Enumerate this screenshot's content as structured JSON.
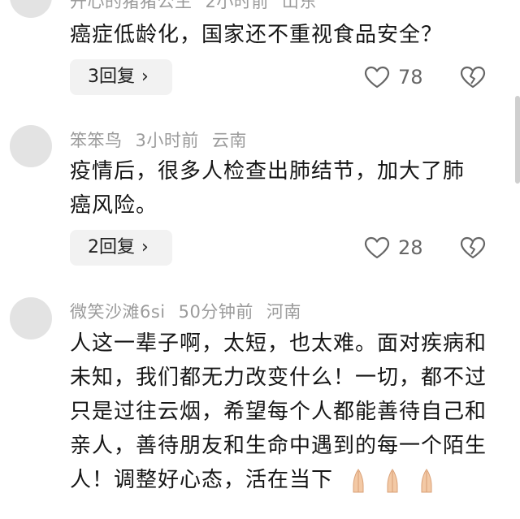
{
  "comments": [
    {
      "author": "开心的猪猪公主",
      "time": "2小时前",
      "location": "山东",
      "text": "癌症低龄化，国家还不重视食品安全？",
      "reply_label": "3回复",
      "likes": "78"
    },
    {
      "author": "笨笨鸟",
      "time": "3小时前",
      "location": "云南",
      "text": "疫情后，很多人检查出肺结节，加大了肺癌风险。",
      "reply_label": "2回复",
      "likes": "28"
    },
    {
      "author": "微笑沙滩6si",
      "time": "50分钟前",
      "location": "河南",
      "text": "人这一辈子啊，太短，也太难。面对疾病和未知，我们都无力改变什么！一切，都不过只是过往云烟，希望每个人都能善待自己和亲人，善待朋友和生命中遇到的每一个陌生人！调整好心态，活在当下",
      "emoji": [
        "pray-hands",
        "pray-hands",
        "pray-hands"
      ]
    }
  ],
  "icons": {
    "like": "heart-outline-icon",
    "dislike": "broken-heart-icon",
    "reply_arrow": "chevron-right-icon",
    "emoji": "pray-hands-icon"
  },
  "colors": {
    "meta_text": "#9b9b9b",
    "reply_bg": "#f2f2f2",
    "emoji": "#f3c9a5"
  }
}
